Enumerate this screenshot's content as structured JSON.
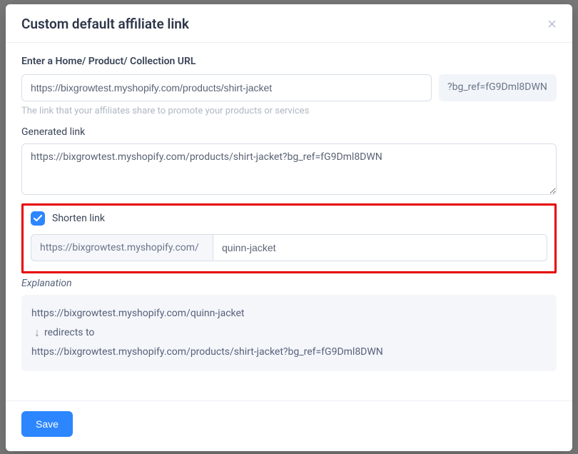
{
  "modal": {
    "title": "Custom default affiliate link"
  },
  "url": {
    "label": "Enter a Home/ Product/ Collection URL",
    "value": "https://bixgrowtest.myshopify.com/products/shirt-jacket",
    "suffix": "?bg_ref=fG9Dml8DWN",
    "help": "The link that your affiliates share to promote your products or services"
  },
  "generated": {
    "label": "Generated link",
    "value": "https://bixgrowtest.myshopify.com/products/shirt-jacket?bg_ref=fG9Dml8DWN"
  },
  "short": {
    "checkbox_label": "Shorten link",
    "base": "https://bixgrowtest.myshopify.com/",
    "slug": "quinn-jacket"
  },
  "expl": {
    "label": "Explanation",
    "short_url": "https://bixgrowtest.myshopify.com/quinn-jacket",
    "redir_text": "redirects to",
    "full_url": "https://bixgrowtest.myshopify.com/products/shirt-jacket?bg_ref=fG9Dml8DWN"
  },
  "footer": {
    "save": "Save"
  }
}
